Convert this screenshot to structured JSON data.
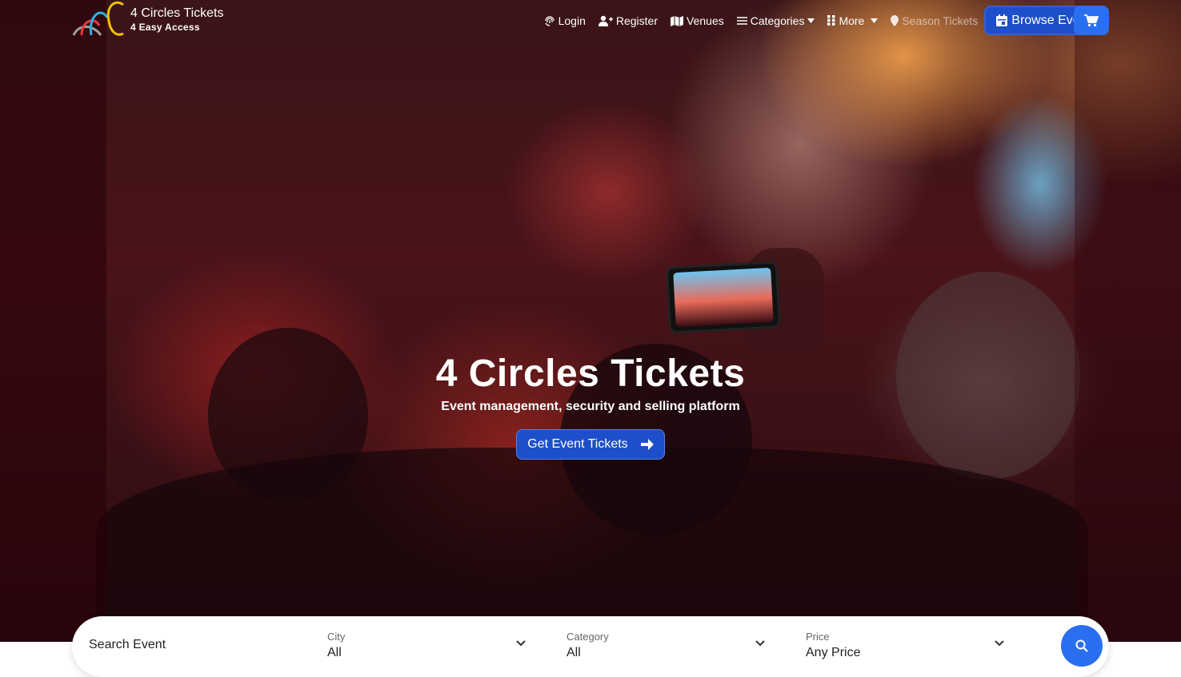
{
  "brand": {
    "title": "4 Circles Tickets",
    "tagline": "4 Easy Access",
    "logo_icon": "four-circles-logo",
    "colors": [
      "#f2c200",
      "#2ab1e8",
      "#e53b3b",
      "#a0a0a0"
    ]
  },
  "nav": {
    "login": "Login",
    "register": "Register",
    "venues": "Venues",
    "categories": "Categories",
    "more": "More",
    "season_tickets": "Season Tickets",
    "browse_events": "Browse Events",
    "cart_icon": "cart-icon"
  },
  "hero": {
    "title": "4 Circles Tickets",
    "subtitle": "Event management, security and selling platform",
    "cta": "Get Event Tickets"
  },
  "search": {
    "placeholder": "Search Event",
    "city_label": "City",
    "city_value": "All",
    "category_label": "Category",
    "category_value": "All",
    "price_label": "Price",
    "price_value": "Any Price"
  },
  "theme": {
    "accent": "#2a6ff0",
    "button_dark": "#1c4fc9"
  }
}
